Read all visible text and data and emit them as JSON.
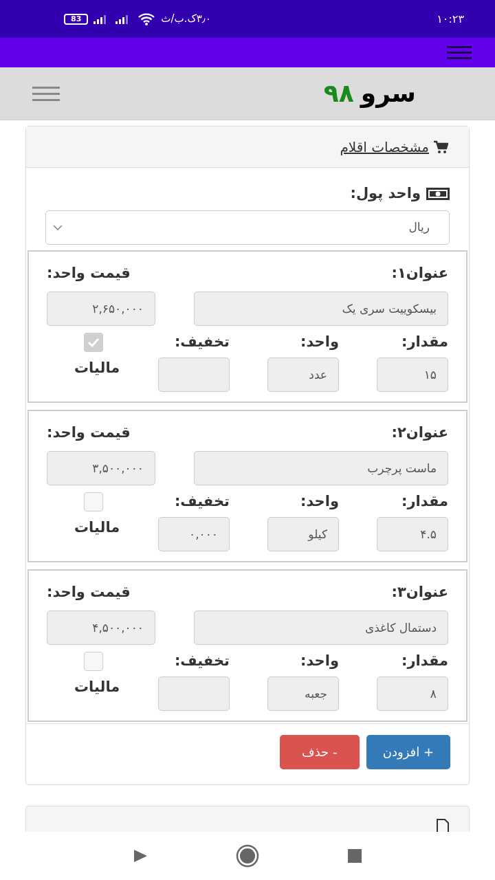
{
  "status_bar": {
    "time": "۱۰:۲۳",
    "speed": "۳٫۰ک.ب/ث",
    "battery": "83"
  },
  "header": {
    "brand": "سرو",
    "brand_number": "۹۸"
  },
  "panel": {
    "title": "مشخصات اقلام",
    "currency_label": "واحد پول:",
    "currency": "ریال"
  },
  "items": [
    {
      "title_label": "عنوان۱:",
      "title": "بیسکوییت سری یک",
      "price_label": "قیمت واحد:",
      "price": "۲,۶۵۰,۰۰۰",
      "qty_label": "مقدار:",
      "qty": "۱۵",
      "unit_label": "واحد:",
      "unit": "عدد",
      "discount_label": "تخفیف:",
      "tax_label": "مالیات",
      "tax_checked": true
    },
    {
      "title_label": "عنوان۲:",
      "title": "ماست پرچرب",
      "price_label": "قیمت واحد:",
      "price": "۳,۵۰۰,۰۰۰",
      "qty_label": "مقدار:",
      "qty": "۴.۵",
      "unit_label": "واحد:",
      "unit": "کیلو",
      "discount_label": "تخفیف:",
      "discount": "۰,۰۰۰",
      "tax_label": "مالیات",
      "tax_checked": false
    },
    {
      "title_label": "عنوان۳:",
      "title": "دستمال کاغذی",
      "price_label": "قیمت واحد:",
      "price": "۴,۵۰۰,۰۰۰",
      "qty_label": "مقدار:",
      "qty": "۸",
      "unit_label": "واحد:",
      "unit": "جعبه",
      "discount_label": "تخفیف:",
      "tax_label": "مالیات",
      "tax_checked": false
    }
  ],
  "buttons": [
    {
      "kind": "add",
      "label": "+ افزودن"
    },
    {
      "kind": "remove",
      "label": "- حذف"
    }
  ]
}
